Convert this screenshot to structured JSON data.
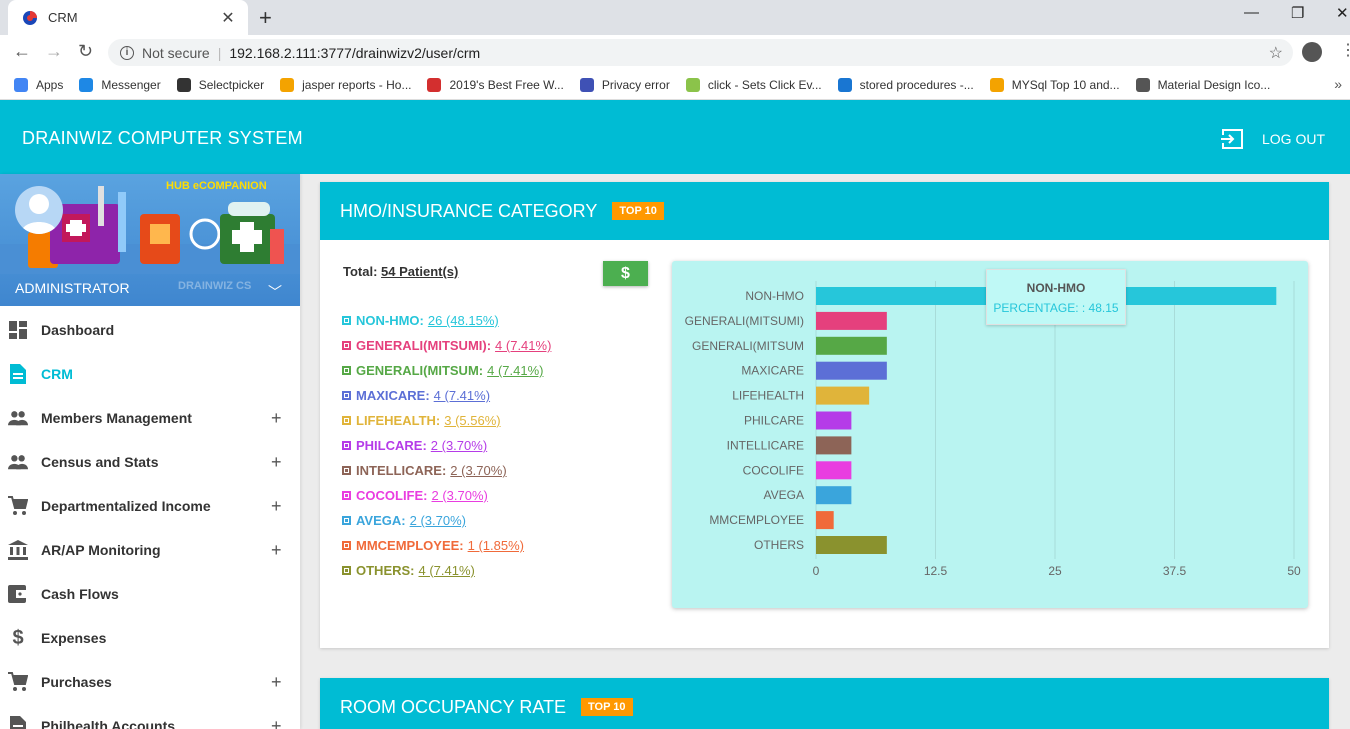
{
  "browser": {
    "tab_title": "CRM",
    "not_secure": "Not secure",
    "url": "192.168.2.111:3777/drainwizv2/user/crm",
    "bookmarks": [
      {
        "label": "Apps",
        "color": "#4285f4"
      },
      {
        "label": "Messenger",
        "color": "#1e88e5"
      },
      {
        "label": "Selectpicker",
        "color": "#333333"
      },
      {
        "label": "jasper reports - Ho...",
        "color": "#f4a300"
      },
      {
        "label": "2019's Best Free W...",
        "color": "#d32f2f"
      },
      {
        "label": "Privacy error",
        "color": "#3f51b5"
      },
      {
        "label": "click - Sets Click Ev...",
        "color": "#8bc34a"
      },
      {
        "label": "stored procedures -...",
        "color": "#1976d2"
      },
      {
        "label": "MYSql Top 10 and...",
        "color": "#f4a300"
      },
      {
        "label": "Material Design Ico...",
        "color": "#555555"
      }
    ]
  },
  "app": {
    "title": "DRAINWIZ COMPUTER SYSTEM",
    "logout": "LOG OUT"
  },
  "sidebar": {
    "banner_text": "HUB eCOMPANION",
    "role": "ADMINISTRATOR",
    "role_sub": "DRAINWIZ CS",
    "items": [
      {
        "label": "Dashboard",
        "icon": "dashboard-icon",
        "expand": ""
      },
      {
        "label": "CRM",
        "icon": "document-icon",
        "expand": "",
        "active": true
      },
      {
        "label": "Members Management",
        "icon": "people-icon",
        "expand": "+"
      },
      {
        "label": "Census and Stats",
        "icon": "people-icon",
        "expand": "+"
      },
      {
        "label": "Departmentalized Income",
        "icon": "cart-icon",
        "expand": "+"
      },
      {
        "label": "AR/AP Monitoring",
        "icon": "bank-icon",
        "expand": "+"
      },
      {
        "label": "Cash Flows",
        "icon": "wallet-icon",
        "expand": ""
      },
      {
        "label": "Expenses",
        "icon": "dollar-icon",
        "expand": ""
      },
      {
        "label": "Purchases",
        "icon": "cart-icon",
        "expand": "+"
      },
      {
        "label": "Philhealth Accounts",
        "icon": "document-icon",
        "expand": "+"
      }
    ]
  },
  "hmo_card": {
    "title": "HMO/INSURANCE CATEGORY",
    "badge": "TOP 10",
    "total_label": "Total:",
    "total_value": "54 Patient(s)",
    "dollar_button": "$",
    "legend": [
      {
        "label": "NON-HMO:",
        "value": "26 (48.15%)",
        "color": "#26c6da"
      },
      {
        "label": "GENERALI(MITSUMI):",
        "value": "4 (7.41%)",
        "color": "#e5407d"
      },
      {
        "label": "GENERALI(MITSUM:",
        "value": "4 (7.41%)",
        "color": "#56a846"
      },
      {
        "label": "MAXICARE:",
        "value": "4 (7.41%)",
        "color": "#5c6fd6"
      },
      {
        "label": "LIFEHEALTH:",
        "value": "3 (5.56%)",
        "color": "#e0b43a"
      },
      {
        "label": "PHILCARE:",
        "value": "2 (3.70%)",
        "color": "#b53be8"
      },
      {
        "label": "INTELLICARE:",
        "value": "2 (3.70%)",
        "color": "#8d6457"
      },
      {
        "label": "COCOLIFE:",
        "value": "2 (3.70%)",
        "color": "#e93de0"
      },
      {
        "label": "AVEGA:",
        "value": "2 (3.70%)",
        "color": "#3aa5dc"
      },
      {
        "label": "MMCEMPLOYEE:",
        "value": "1 (1.85%)",
        "color": "#f06a3a"
      },
      {
        "label": "OTHERS:",
        "value": "4 (7.41%)",
        "color": "#8a922e"
      }
    ],
    "tooltip": {
      "title": "NON-HMO",
      "text": "PERCENTAGE: : 48.15"
    }
  },
  "chart_data": {
    "type": "bar",
    "orientation": "horizontal",
    "categories": [
      "NON-HMO",
      "GENERALI(MITSUMI)",
      "GENERALI(MITSUM",
      "MAXICARE",
      "LIFEHEALTH",
      "PHILCARE",
      "INTELLICARE",
      "COCOLIFE",
      "AVEGA",
      "MMCEMPLOYEE",
      "OTHERS"
    ],
    "values": [
      48.15,
      7.41,
      7.41,
      7.41,
      5.56,
      3.7,
      3.7,
      3.7,
      3.7,
      1.85,
      7.41
    ],
    "colors": [
      "#26c6da",
      "#e5407d",
      "#56a846",
      "#5c6fd6",
      "#e0b43a",
      "#b53be8",
      "#8d6457",
      "#e93de0",
      "#3aa5dc",
      "#f06a3a",
      "#8a922e"
    ],
    "xticks": [
      "0",
      "12.5",
      "25",
      "37.5",
      "50"
    ],
    "xlim": [
      0,
      50
    ],
    "grid": true,
    "title": "",
    "xlabel": "",
    "ylabel": ""
  },
  "room_card": {
    "title": "ROOM OCCUPANCY RATE",
    "badge": "TOP 10"
  }
}
